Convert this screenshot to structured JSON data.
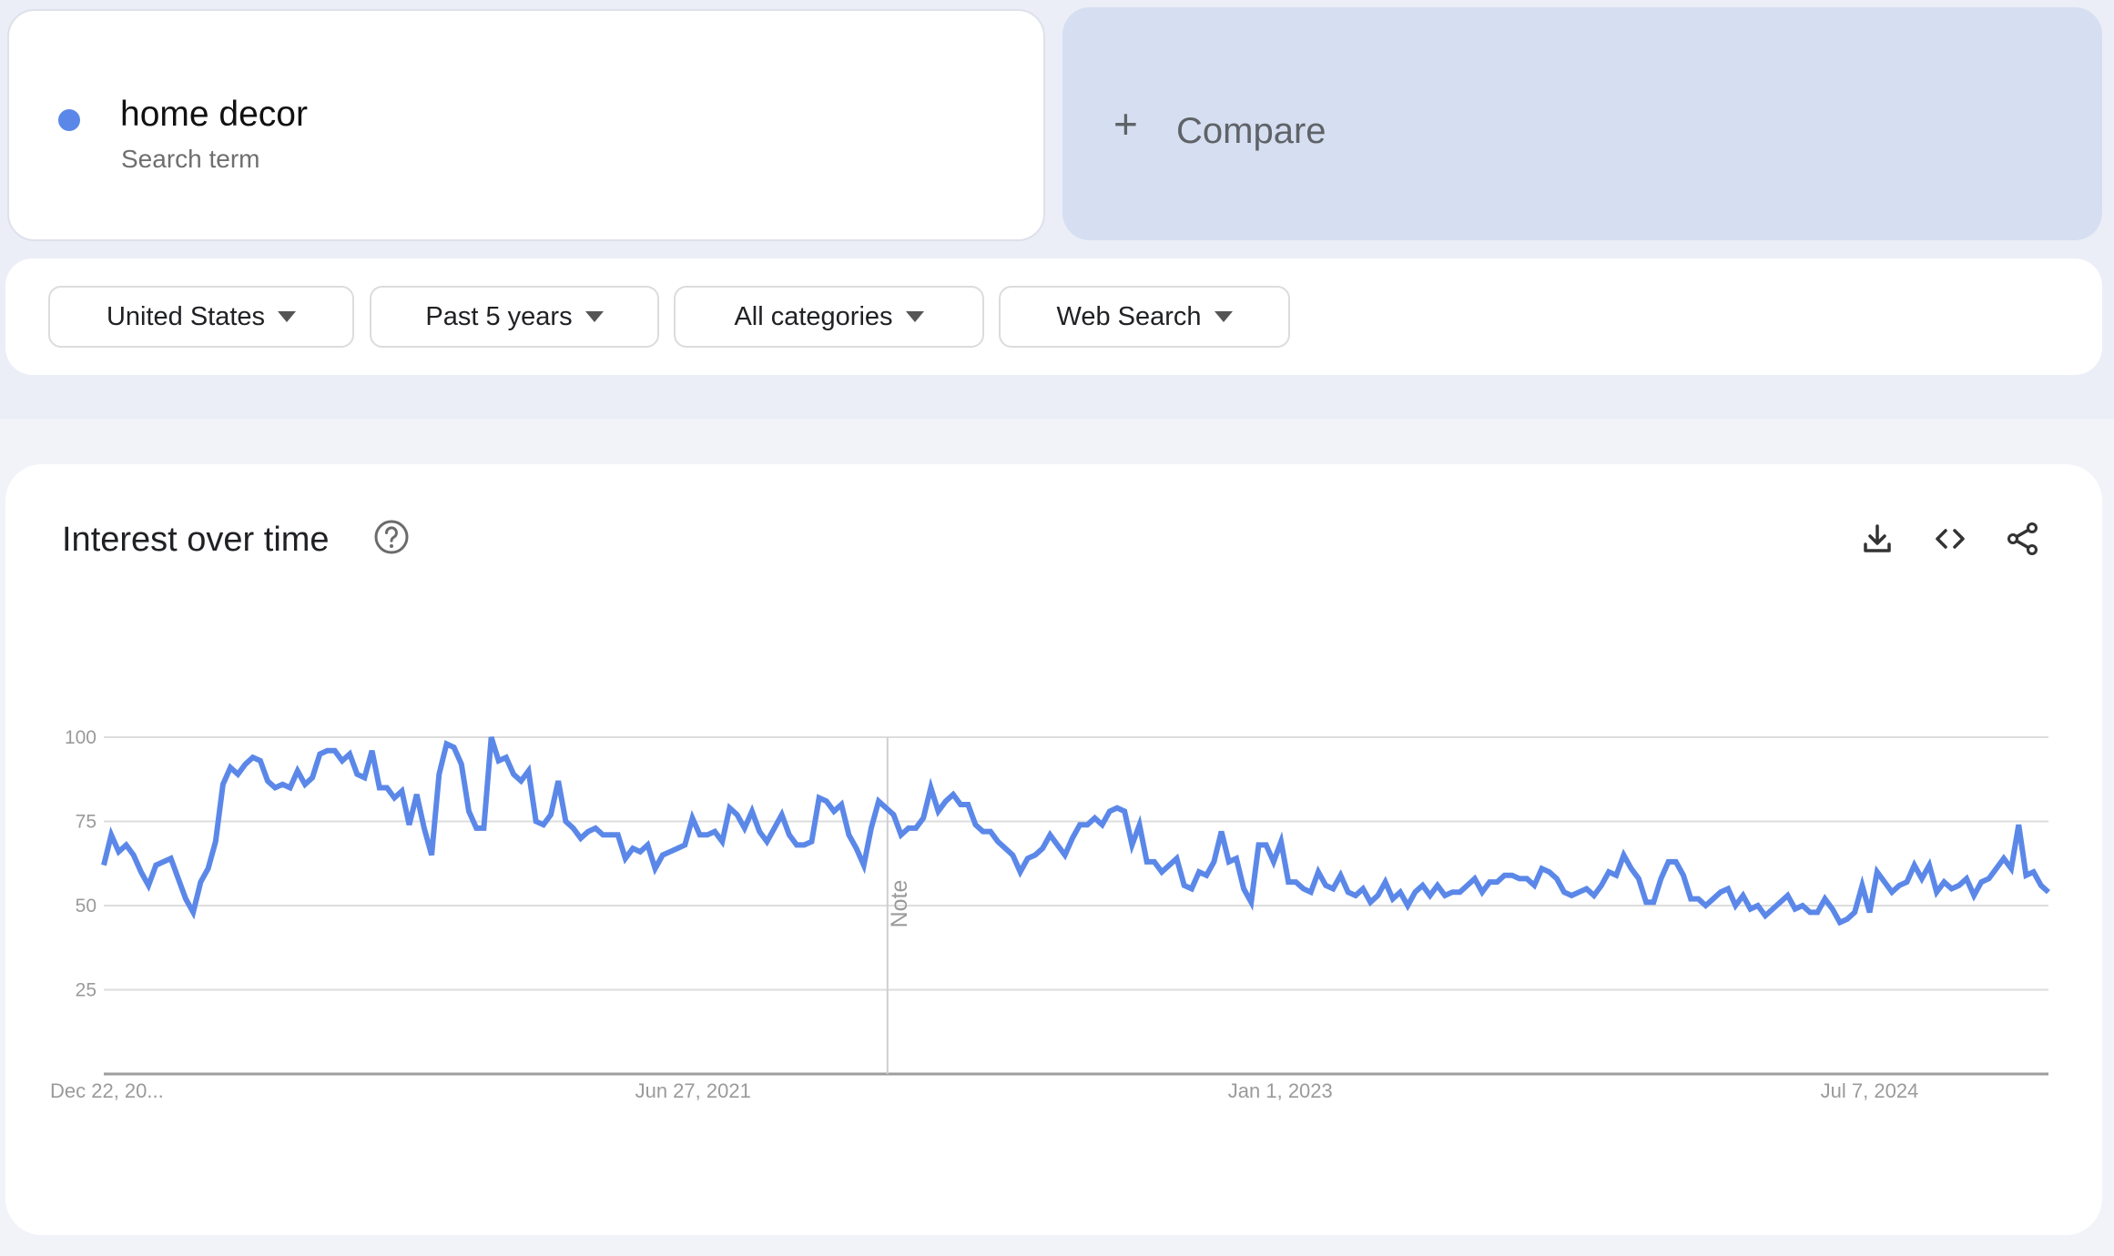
{
  "search_term": {
    "name": "home decor",
    "subtitle": "Search term",
    "color": "#5b88e8"
  },
  "compare": {
    "icon": "plus-icon",
    "label": "Compare"
  },
  "filters": [
    {
      "label": "United States",
      "icon": "dropdown-caret-icon"
    },
    {
      "label": "Past 5 years",
      "icon": "dropdown-caret-icon"
    },
    {
      "label": "All categories",
      "icon": "dropdown-caret-icon"
    },
    {
      "label": "Web Search",
      "icon": "dropdown-caret-icon"
    }
  ],
  "panel": {
    "title": "Interest over time",
    "help_icon": "help-circle-icon",
    "tools": [
      "download-icon",
      "embed-code-icon",
      "share-icon"
    ]
  },
  "chart_data": {
    "type": "line",
    "title": "Interest over time",
    "xlabel": "",
    "ylabel": "",
    "ylim": [
      0,
      100
    ],
    "yticks": [
      25,
      50,
      75,
      100
    ],
    "ytick_labels": [
      "25",
      "50",
      "75",
      "100"
    ],
    "xtick_labels": [
      "Dec 22, 20...",
      "Jun 27, 2021",
      "Jan 1, 2023",
      "Jul 7, 2024"
    ],
    "xtick_positions": [
      0,
      0.303,
      0.605,
      0.908
    ],
    "annotation": {
      "label": "Note",
      "position": 0.403
    },
    "grid": true,
    "legend": "none",
    "series": [
      {
        "name": "home decor",
        "color": "#5b88e8",
        "values": [
          62,
          71,
          66,
          68,
          65,
          60,
          56,
          62,
          63,
          64,
          58,
          52,
          48,
          57,
          61,
          69,
          86,
          91,
          89,
          92,
          94,
          93,
          87,
          85,
          86,
          85,
          90,
          86,
          88,
          95,
          96,
          96,
          93,
          95,
          89,
          88,
          96,
          85,
          85,
          82,
          84,
          74,
          83,
          73,
          65,
          89,
          98,
          97,
          92,
          78,
          73,
          73,
          100,
          93,
          94,
          89,
          87,
          90,
          75,
          74,
          77,
          87,
          75,
          73,
          70,
          72,
          73,
          71,
          71,
          71,
          64,
          67,
          66,
          68,
          61,
          65,
          66,
          67,
          68,
          76,
          71,
          71,
          72,
          69,
          79,
          77,
          73,
          78,
          72,
          69,
          73,
          77,
          71,
          68,
          68,
          69,
          82,
          81,
          78,
          80,
          71,
          67,
          62,
          73,
          81,
          79,
          77,
          71,
          73,
          73,
          76,
          85,
          78,
          81,
          83,
          80,
          80,
          74,
          72,
          72,
          69,
          67,
          65,
          60,
          64,
          65,
          67,
          71,
          68,
          65,
          70,
          74,
          74,
          76,
          74,
          78,
          79,
          78,
          68,
          74,
          63,
          63,
          60,
          62,
          64,
          56,
          55,
          60,
          59,
          63,
          72,
          63,
          64,
          55,
          51,
          68,
          68,
          63,
          69,
          57,
          57,
          55,
          54,
          60,
          56,
          55,
          59,
          54,
          53,
          55,
          51,
          53,
          57,
          52,
          54,
          50,
          54,
          56,
          53,
          56,
          53,
          54,
          54,
          56,
          58,
          54,
          57,
          57,
          59,
          59,
          58,
          58,
          56,
          61,
          60,
          58,
          54,
          53,
          54,
          55,
          53,
          56,
          60,
          59,
          65,
          61,
          58,
          51,
          51,
          58,
          63,
          63,
          59,
          52,
          52,
          50,
          52,
          54,
          55,
          50,
          53,
          49,
          50,
          47,
          49,
          51,
          53,
          49,
          50,
          48,
          48,
          52,
          49,
          45,
          46,
          48,
          56,
          48,
          60,
          57,
          54,
          56,
          57,
          62,
          58,
          62,
          54,
          57,
          55,
          56,
          58,
          53,
          57,
          58,
          61,
          64,
          61,
          74,
          59,
          60,
          56,
          54
        ]
      }
    ]
  }
}
